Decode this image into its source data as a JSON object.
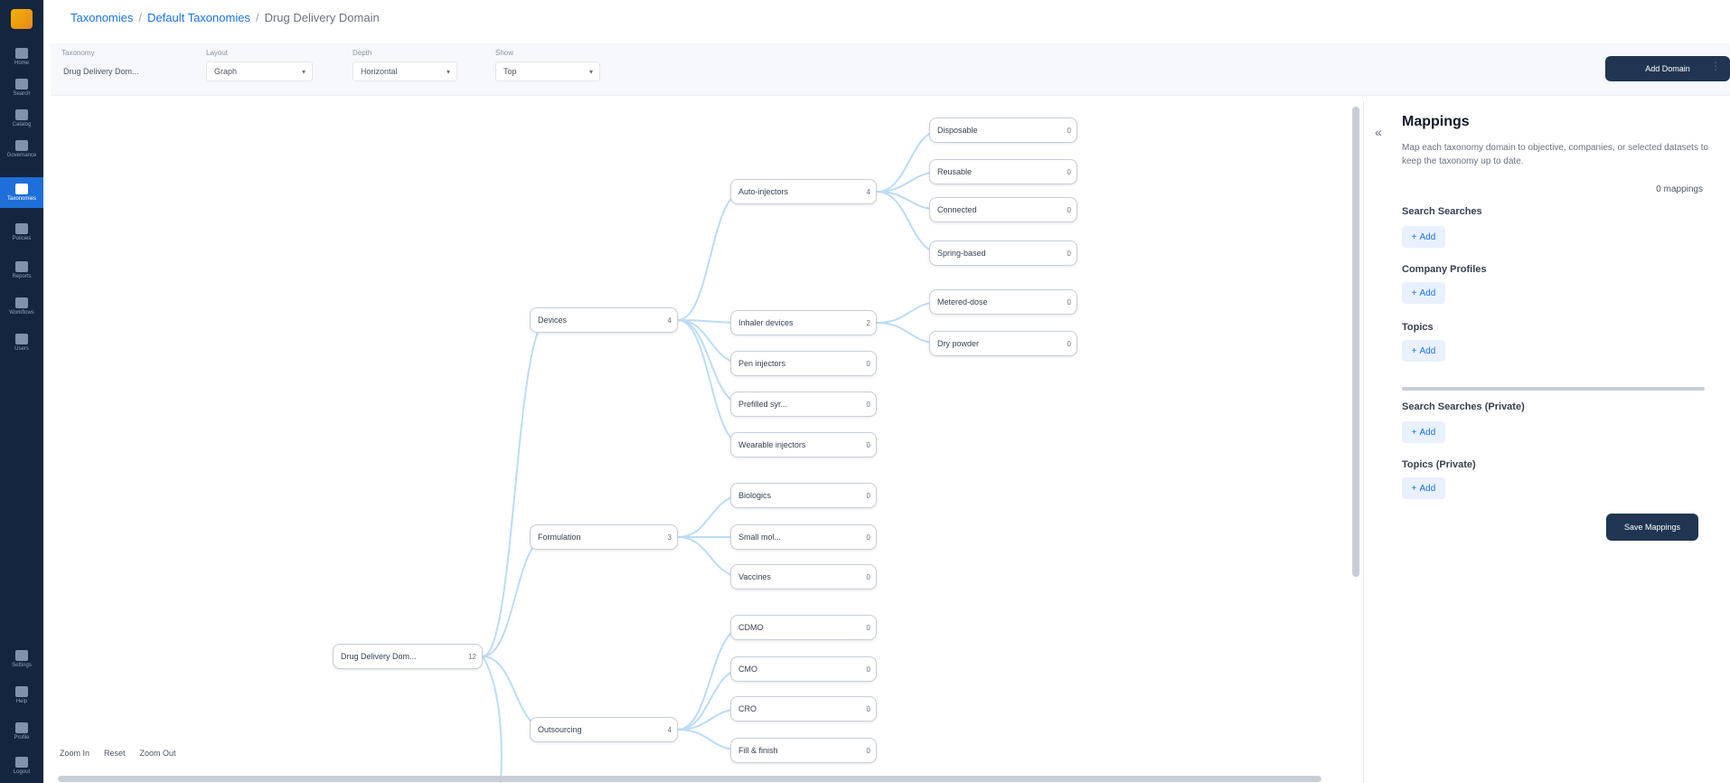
{
  "sidebar": {
    "items": [
      {
        "label": "Home"
      },
      {
        "label": "Search"
      },
      {
        "label": "Catalog"
      },
      {
        "label": "Governance"
      },
      {
        "label": "Taxonomies",
        "active": true
      },
      {
        "label": "Policies"
      },
      {
        "label": "Reports"
      },
      {
        "label": "Workflows"
      },
      {
        "label": "Users"
      },
      {
        "label": "Settings"
      },
      {
        "label": "Help"
      },
      {
        "label": "Profile"
      },
      {
        "label": "Logout"
      }
    ]
  },
  "breadcrumb": {
    "items": [
      "Taxonomies",
      "Default Taxonomies",
      "Drug Delivery Domain"
    ]
  },
  "filters": {
    "taxonomy": {
      "label": "Taxonomy",
      "value": "Drug Delivery Dom..."
    },
    "layout": {
      "label": "Layout",
      "value": "Graph"
    },
    "depth": {
      "label": "Depth",
      "value": "Horizontal"
    },
    "scope": {
      "label": "Show",
      "value": "Top"
    },
    "action_label": "Add Domain"
  },
  "tree": {
    "root": {
      "label": "Drug Delivery Dom...",
      "count": "12"
    },
    "level1": [
      {
        "label": "Devices",
        "count": "4"
      },
      {
        "label": "Formulation",
        "count": "3"
      },
      {
        "label": "Outsourcing",
        "count": "4"
      }
    ],
    "level2": [
      {
        "label": "Auto-injectors",
        "count": "4"
      },
      {
        "label": "Inhaler devices",
        "count": "2"
      },
      {
        "label": "Pen injectors",
        "count": "0"
      },
      {
        "label": "Prefilled syr...",
        "count": "0"
      },
      {
        "label": "Wearable injectors",
        "count": "0"
      },
      {
        "label": "Biologics",
        "count": "0"
      },
      {
        "label": "Small mol...",
        "count": "0"
      },
      {
        "label": "Vaccines",
        "count": "0"
      },
      {
        "label": "CDMO",
        "count": "0"
      },
      {
        "label": "CMO",
        "count": "0"
      },
      {
        "label": "CRO",
        "count": "0"
      },
      {
        "label": "Fill & finish",
        "count": "0"
      }
    ],
    "level3": [
      {
        "label": "Disposable",
        "count": "0"
      },
      {
        "label": "Reusable",
        "count": "0"
      },
      {
        "label": "Connected",
        "count": "0"
      },
      {
        "label": "Spring-based",
        "count": "0"
      },
      {
        "label": "Metered-dose",
        "count": "0"
      },
      {
        "label": "Dry powder",
        "count": "0"
      }
    ]
  },
  "zoom": {
    "zoom_in": "Zoom In",
    "reset": "Reset",
    "zoom_out": "Zoom Out"
  },
  "panel": {
    "title": "Mappings",
    "description": "Map each taxonomy domain to objective, companies, or selected datasets to keep the taxonomy up to date.",
    "count": "0 mappings",
    "sections": [
      {
        "label": "Search Searches",
        "add_label": "Add"
      },
      {
        "label": "Company Profiles",
        "add_label": "Add"
      },
      {
        "label": "Topics",
        "add_label": "Add"
      },
      {
        "label": "Search Searches (Private)",
        "add_label": "Add"
      },
      {
        "label": "Topics (Private)",
        "add_label": "Add"
      }
    ],
    "save_label": "Save Mappings"
  },
  "colors": {
    "sidebar_bg": "#14263f",
    "accent": "#1a73e8",
    "link_line": "#bcdcf6",
    "primary_button": "#1f3551"
  }
}
